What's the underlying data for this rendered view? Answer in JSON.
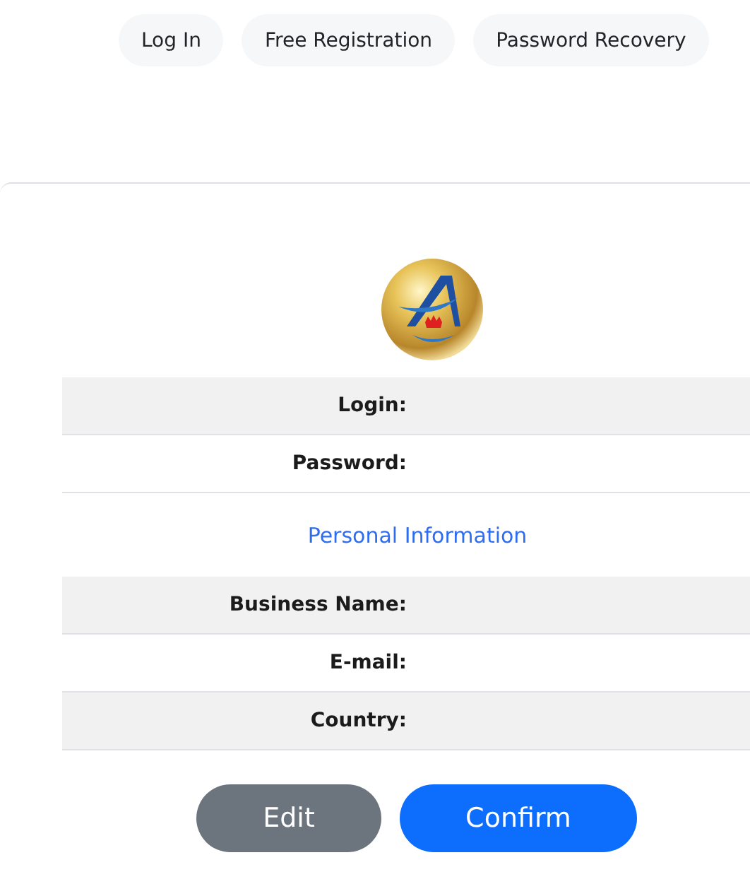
{
  "nav": [
    {
      "label": "Log In"
    },
    {
      "label": "Free Registration"
    },
    {
      "label": "Password Recovery"
    }
  ],
  "account_rows": [
    {
      "label": "Login:"
    },
    {
      "label": "Password:"
    }
  ],
  "section_title": "Personal Information",
  "personal_rows": [
    {
      "label": "Business Name:"
    },
    {
      "label": "E-mail:"
    },
    {
      "label": "Country:"
    }
  ],
  "buttons": [
    {
      "label": "Edit",
      "kind": "secondary"
    },
    {
      "label": "Confirm",
      "kind": "primary"
    }
  ]
}
